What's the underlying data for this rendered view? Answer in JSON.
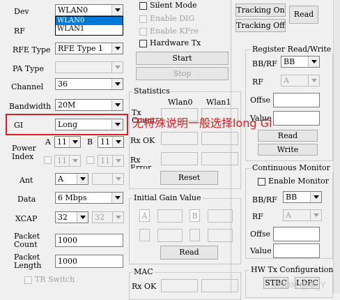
{
  "left": {
    "dev_label": "Dev",
    "dev_value": "WLAN0",
    "dev_options": [
      "WLAN0",
      "WLAN1"
    ],
    "rf_label": "RF",
    "rfe_type_label": "RFE Type",
    "rfe_type_value": "RFE Type 1",
    "pa_type_label": "PA Type",
    "channel_label": "Channel",
    "channel_value": "36",
    "bandwidth_label": "Bandwidth",
    "bandwidth_value": "20M",
    "gi_label": "GI",
    "gi_value": "Long",
    "power_index_label": "Power\nIndex",
    "power_a_label": "A",
    "power_a_value": "11",
    "power_b_label": "B",
    "power_b_value": "11",
    "power_c_value": "11",
    "power_d_value": "11",
    "ant_label": "Ant",
    "ant_value": "A",
    "data_label": "Data",
    "data_value": "6 Mbps",
    "xcap_label": "XCAP",
    "xcap_value": "32",
    "xcap_value2": "32",
    "packet_count_label": "Packet\nCount",
    "packet_count_value": "1000",
    "packet_length_label": "Packet\nLength",
    "packet_length_value": "1000",
    "tr_switch_label": "TR Switch"
  },
  "middle": {
    "silent_mode_label": "Silent Mode",
    "enable_dig_label": "Enable DIG",
    "enable_kfree_label": "Enable KFree",
    "hardware_tx_label": "Hardware Tx",
    "start_label": "Start",
    "stop_label": "Stop",
    "statistics_title": "Statistics",
    "stats_col_wlan0": "Wlan0",
    "stats_col_wlan1": "Wlan1",
    "tx_count_label": "Tx\nCount",
    "rx_ok_label": "Rx OK",
    "rx_error_label": "Rx\nError",
    "reset_label": "Reset",
    "initial_gain_title": "Initial Gain Value",
    "gain_a_label": "A",
    "gain_b_label": "B",
    "read_label": "Read",
    "mac_title": "MAC",
    "mac_rx_ok_label": "Rx OK"
  },
  "right": {
    "tracking_on_label": "Tracking On",
    "tracking_off_label": "Tracking Off",
    "read_label": "Read",
    "register_title": "Register Read/Write",
    "bbrf_label": "BB/RF",
    "bbrf_value": "BB",
    "rf_label": "RF",
    "rf_value": "A",
    "offset_label": "Offse",
    "value_label": "Value",
    "reg_read_label": "Read",
    "reg_write_label": "Write",
    "continuous_title": "Continuous Monitor",
    "enable_monitor_label": "Enable Monitor",
    "cm_bbrf_label": "BB/RF",
    "cm_bbrf_value": "BB",
    "cm_rf_label": "RF",
    "cm_rf_value": "A",
    "cm_offset_label": "Offse",
    "cm_value_label": "Value",
    "hwtx_title": "HW Tx Configuration",
    "hwtx_btn1": "STBC",
    "hwtx_btn2": "LDPC"
  },
  "annotation": {
    "text": "无特殊说明一般选择long GI",
    "color": "#e02020"
  },
  "watermark": "CSDN @李_Y"
}
